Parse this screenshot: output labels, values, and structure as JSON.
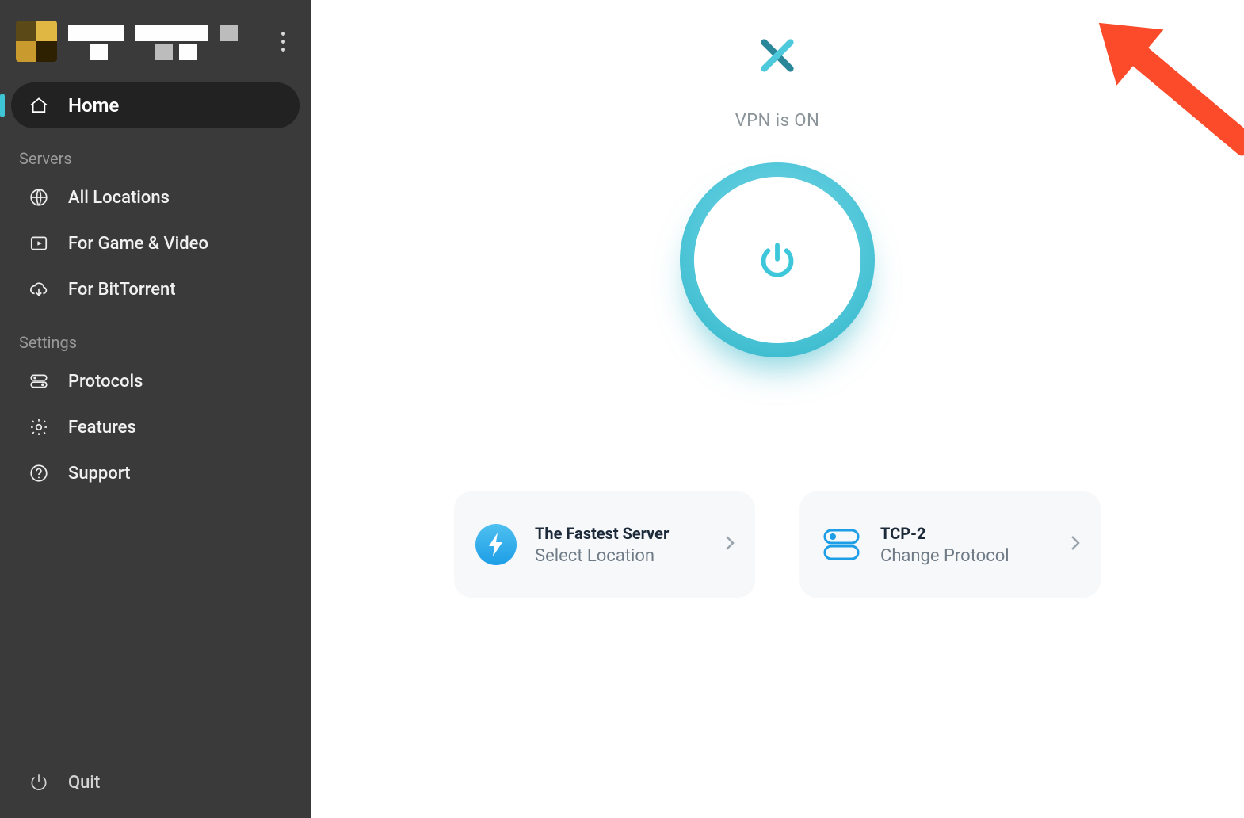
{
  "sidebar": {
    "home_label": "Home",
    "section_servers": "Servers",
    "item_all_locations": "All Locations",
    "item_game_video": "For Game & Video",
    "item_bittorrent": "For BitTorrent",
    "section_settings": "Settings",
    "item_protocols": "Protocols",
    "item_features": "Features",
    "item_support": "Support",
    "quit_label": "Quit"
  },
  "main": {
    "status_text": "VPN is ON",
    "location_card": {
      "title": "The Fastest Server",
      "sub": "Select Location"
    },
    "protocol_card": {
      "title": "TCP-2",
      "sub": "Change Protocol"
    }
  }
}
